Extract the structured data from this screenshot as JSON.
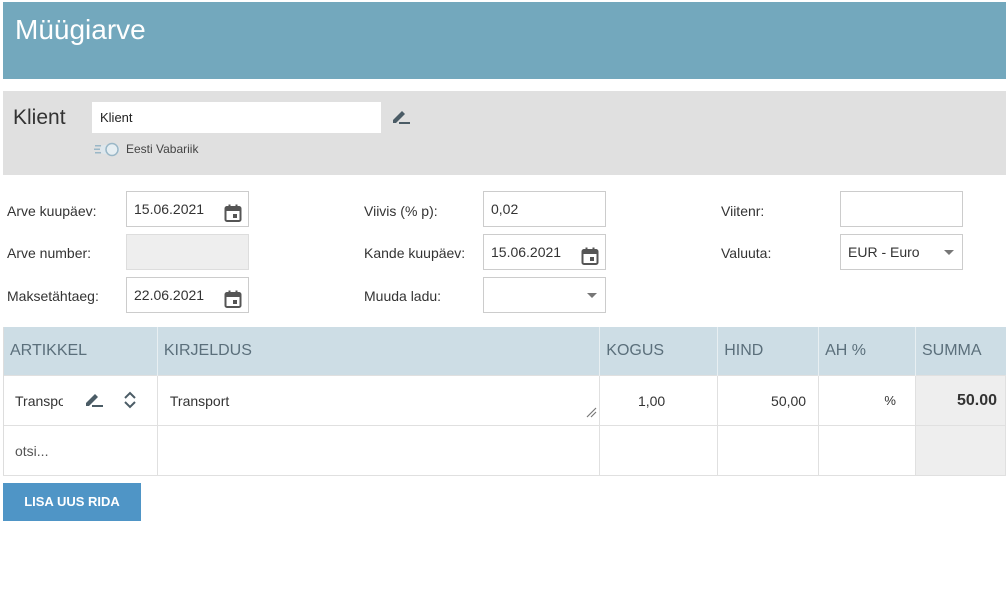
{
  "page": {
    "title": "Müügiarve"
  },
  "client": {
    "label": "Klient",
    "input_value": "Klient",
    "country": "Eesti Vabariik"
  },
  "fields": {
    "invoice_date_label": "Arve kuupäev:",
    "invoice_date_value": "15.06.2021",
    "invoice_number_label": "Arve number:",
    "invoice_number_value": "",
    "due_date_label": "Maksetähtaeg:",
    "due_date_value": "22.06.2021",
    "penalty_label": "Viivis (% p):",
    "penalty_value": "0,02",
    "entry_date_label": "Kande kuupäev:",
    "entry_date_value": "15.06.2021",
    "warehouse_label": "Muuda ladu:",
    "warehouse_value": "",
    "reference_label": "Viitenr:",
    "reference_value": "",
    "currency_label": "Valuuta:",
    "currency_value": "EUR - Euro"
  },
  "table": {
    "headers": [
      "ARTIKKEL",
      "KIRJELDUS",
      "KOGUS",
      "HIND",
      "AH %",
      "SUMMA"
    ],
    "rows": [
      {
        "article": "Transport",
        "description": "Transport",
        "quantity": "1,00",
        "price": "50,00",
        "vat": "%",
        "sum": "50.00"
      }
    ],
    "search_placeholder": "otsi..."
  },
  "buttons": {
    "add_row": "LISA UUS RIDA"
  },
  "colors": {
    "header_bg": "#73a8bd",
    "client_bar_bg": "#e0e0e0",
    "table_header_bg": "#cddde5",
    "button_bg": "#4f95c6"
  }
}
